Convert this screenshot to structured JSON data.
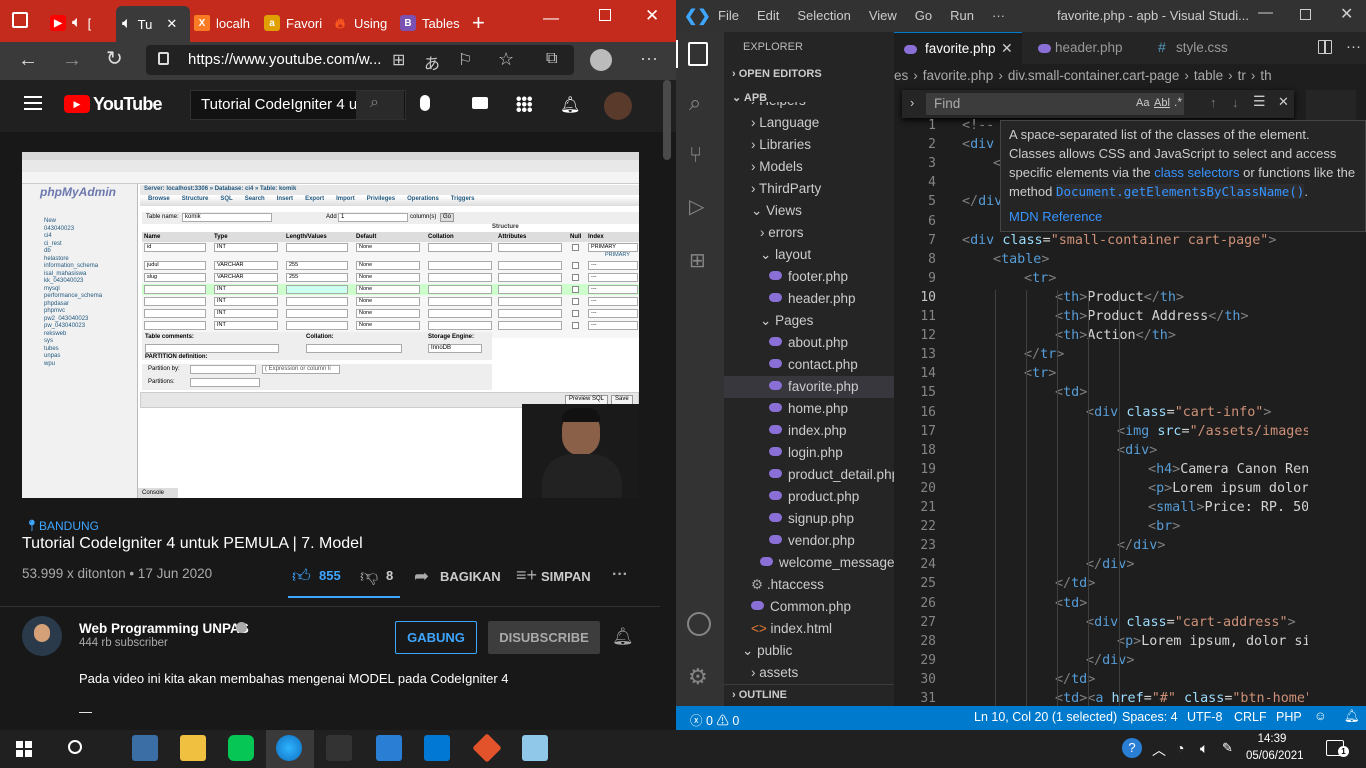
{
  "browser": {
    "tabs": [
      {
        "label": "[",
        "favicon": "youtube"
      },
      {
        "label": "Tu",
        "favicon": "speaker"
      },
      {
        "label": "localh",
        "favicon": "xampp"
      },
      {
        "label": "Favori",
        "favicon": "codeigniter"
      },
      {
        "label": "Using",
        "favicon": "codeigniter-flame"
      },
      {
        "label": "Tables",
        "favicon": "bootstrap"
      }
    ],
    "url": "https://www.youtube.com/w...",
    "accent_color": "#c42b1c"
  },
  "youtube": {
    "logo_text": "YouTube",
    "search_value": "Tutorial CodeIgniter 4 u",
    "channel_location": "BANDUNG",
    "video_title": "Tutorial CodeIgniter 4 untuk PEMULA | 7. Model",
    "views_date": "53.999 x ditonton • 17 Jun 2020",
    "likes": "855",
    "dislikes": "8",
    "share_label": "BAGIKAN",
    "save_label": "SIMPAN",
    "channel_name": "Web Programming UNPAS",
    "subscribers": "444 rb subscriber",
    "join_label": "GABUNG",
    "subscribe_label": "DISUBSCRIBE",
    "description": "Pada video ini kita akan membahas mengenai MODEL pada CodeIgniter 4",
    "description_more": "—",
    "video_frame": {
      "pma_logo": "phpMyAdmin",
      "breadcrumb": "Server: localhost:3306 » Database: ci4 » Table: komik",
      "tabs": [
        "Browse",
        "Structure",
        "SQL",
        "Search",
        "Insert",
        "Export",
        "Import",
        "Privileges",
        "Operations",
        "Triggers"
      ],
      "table_name_label": "Table name:",
      "table_name": "komik",
      "add_label": "Add",
      "add_value": "1",
      "columns_label": "column(s)",
      "go_label": "Go",
      "headers": [
        "Name",
        "Type",
        "Length/Values",
        "Default",
        "Collation",
        "Attributes",
        "Null",
        "Index"
      ],
      "rows": [
        {
          "name": "id",
          "type": "INT",
          "len": "",
          "def": "None",
          "index": "PRIMARY"
        },
        {
          "name": "judul",
          "type": "VARCHAR",
          "len": "255",
          "def": "None",
          "index": "---"
        },
        {
          "name": "slug",
          "type": "VARCHAR",
          "len": "255",
          "def": "None",
          "index": "---"
        },
        {
          "name": "",
          "type": "INT",
          "len": "",
          "def": "None",
          "index": "---"
        },
        {
          "name": "",
          "type": "INT",
          "len": "",
          "def": "None",
          "index": "---"
        },
        {
          "name": "",
          "type": "INT",
          "len": "",
          "def": "None",
          "index": "---"
        },
        {
          "name": "",
          "type": "INT",
          "len": "",
          "def": "None",
          "index": "---"
        }
      ],
      "databases": [
        "New",
        "043040023",
        "ci4",
        "ci_rest",
        "db",
        "helastore",
        "information_schema",
        "isal_mahasiswa",
        "kk_043040023",
        "mysql",
        "performance_schema",
        "phpdasar",
        "phpmvc",
        "pw2_043040023",
        "pw_043040023",
        "reksweb",
        "sys",
        "tubes",
        "unpas",
        "wpu"
      ],
      "table_comments": "Table comments:",
      "collation": "Collation:",
      "storage_engine": "Storage Engine:",
      "engine_value": "InnoDB",
      "partition": "PARTITION definition:",
      "partition_by": "Partition by:",
      "partitions": "Partitions:",
      "expression": "( Expression or column li",
      "preview_sql": "Preview SQL",
      "save": "Save",
      "console": "Console",
      "primary_note": "PRIMARY",
      "structure_note": "Structure"
    }
  },
  "vscode": {
    "title": "favorite.php - apb - Visual Studi...",
    "menu": [
      "File",
      "Edit",
      "Selection",
      "View",
      "Go",
      "Run",
      "···"
    ],
    "explorer_label": "EXPLORER",
    "open_editors": "OPEN EDITORS",
    "project": "APB",
    "tree": [
      {
        "label": "Helpers",
        "kind": "folder",
        "indent": 1
      },
      {
        "label": "Language",
        "kind": "folder",
        "indent": 1
      },
      {
        "label": "Libraries",
        "kind": "folder",
        "indent": 1
      },
      {
        "label": "Models",
        "kind": "folder",
        "indent": 1
      },
      {
        "label": "ThirdParty",
        "kind": "folder",
        "indent": 1
      },
      {
        "label": "Views",
        "kind": "folder-open",
        "indent": 1
      },
      {
        "label": "errors",
        "kind": "folder",
        "indent": 2
      },
      {
        "label": "layout",
        "kind": "folder-open",
        "indent": 2
      },
      {
        "label": "footer.php",
        "kind": "php",
        "indent": 3
      },
      {
        "label": "header.php",
        "kind": "php",
        "indent": 3
      },
      {
        "label": "Pages",
        "kind": "folder-open",
        "indent": 2
      },
      {
        "label": "about.php",
        "kind": "php",
        "indent": 3
      },
      {
        "label": "contact.php",
        "kind": "php",
        "indent": 3
      },
      {
        "label": "favorite.php",
        "kind": "php-selected",
        "indent": 3
      },
      {
        "label": "home.php",
        "kind": "php",
        "indent": 3
      },
      {
        "label": "index.php",
        "kind": "php",
        "indent": 3
      },
      {
        "label": "login.php",
        "kind": "php",
        "indent": 3
      },
      {
        "label": "product_detail.php",
        "kind": "php",
        "indent": 3
      },
      {
        "label": "product.php",
        "kind": "php",
        "indent": 3
      },
      {
        "label": "signup.php",
        "kind": "php",
        "indent": 3
      },
      {
        "label": "vendor.php",
        "kind": "php",
        "indent": 3
      },
      {
        "label": "welcome_message....",
        "kind": "php",
        "indent": 2
      },
      {
        "label": ".htaccess",
        "kind": "gear",
        "indent": 1
      },
      {
        "label": "Common.php",
        "kind": "php",
        "indent": 1
      },
      {
        "label": "index.html",
        "kind": "html",
        "indent": 1
      },
      {
        "label": "public",
        "kind": "folder-open",
        "indent": 0
      },
      {
        "label": "assets",
        "kind": "folder",
        "indent": 1
      }
    ],
    "outline": "OUTLINE",
    "tabs": [
      {
        "label": "favorite.php",
        "active": true
      },
      {
        "label": "header.php",
        "active": false
      },
      {
        "label": "style.css",
        "active": false
      }
    ],
    "breadcrumb": [
      "es",
      "favorite.php",
      "div.small-container.cart-page",
      "table",
      "tr",
      "th"
    ],
    "find_placeholder": "Find",
    "find_opts": [
      "Aa",
      "Abl",
      ".*"
    ],
    "tooltip": {
      "text1": "A space-separated list of the classes of the element. Classes allows CSS and JavaScript to select and access specific elements via the ",
      "link1": "class selectors",
      "text2": " or functions like the method ",
      "code": "Document.getElementsByClassName()",
      "text3": ".",
      "ref": "MDN Reference"
    },
    "lines": [
      "1",
      "2",
      "3",
      "4",
      "5",
      "6",
      "7",
      "8",
      "9",
      "10",
      "11",
      "12",
      "13",
      "14",
      "15",
      "16",
      "17",
      "18",
      "19",
      "20",
      "21",
      "22",
      "23",
      "24",
      "25",
      "26",
      "27",
      "28",
      "29",
      "30",
      "31"
    ],
    "status": {
      "errors": "0",
      "warnings": "0",
      "position": "Ln 10, Col 20 (1 selected)",
      "spaces": "Spaces: 4",
      "encoding": "UTF-8",
      "eol": "CRLF",
      "language": "PHP"
    }
  },
  "taskbar": {
    "time": "14:39",
    "date": "05/06/2021",
    "notifications": "1"
  }
}
